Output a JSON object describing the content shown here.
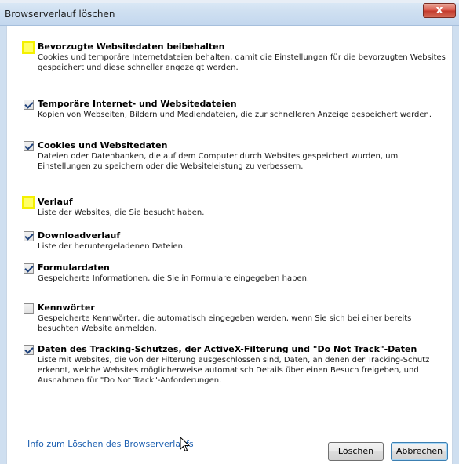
{
  "window": {
    "title": "Browserverlauf löschen",
    "close_label": "x"
  },
  "options": [
    {
      "title": "Bevorzugte Websitedaten beibehalten",
      "desc": "Cookies und temporäre Internetdateien behalten, damit die Einstellungen für die bevorzugten Websites gespeichert und diese schneller angezeigt werden.",
      "checked": false,
      "highlighted": true
    },
    {
      "title": "Temporäre Internet- und Websitedateien",
      "desc": "Kopien von Webseiten, Bildern und Mediendateien, die zur schnelleren Anzeige gespeichert werden.",
      "checked": true,
      "highlighted": false
    },
    {
      "title": "Cookies und Websitedaten",
      "desc": "Dateien oder Datenbanken, die auf dem Computer durch Websites gespeichert wurden, um Einstellungen zu speichern oder die Websiteleistung zu verbessern.",
      "checked": true,
      "highlighted": false
    },
    {
      "title": "Verlauf",
      "desc": "Liste der Websites, die Sie besucht haben.",
      "checked": false,
      "highlighted": true
    },
    {
      "title": "Downloadverlauf",
      "desc": "Liste der heruntergeladenen Dateien.",
      "checked": true,
      "highlighted": false
    },
    {
      "title": "Formulardaten",
      "desc": "Gespeicherte Informationen, die Sie in Formulare eingegeben haben.",
      "checked": true,
      "highlighted": false
    },
    {
      "title": "Kennwörter",
      "desc": "Gespeicherte Kennwörter, die automatisch eingegeben werden, wenn Sie sich bei einer bereits besuchten Website anmelden.",
      "checked": false,
      "highlighted": false
    },
    {
      "title": "Daten des Tracking-Schutzes, der ActiveX-Filterung und \"Do Not Track\"-Daten",
      "desc": "Liste mit Websites, die von der Filterung ausgeschlossen sind, Daten, an denen der Tracking-Schutz erkennt, welche Websites möglicherweise automatisch Details über einen Besuch freigeben, und Ausnahmen für \"Do Not Track\"-Anforderungen.",
      "checked": true,
      "highlighted": false
    }
  ],
  "footer": {
    "help_link": "Info zum Löschen des Browserverlaufs",
    "delete_button": "Löschen",
    "cancel_button": "Abbrechen"
  },
  "colors": {
    "highlight": "#f4f000",
    "link": "#1c5fb0",
    "close_button": "#c23a2c"
  }
}
